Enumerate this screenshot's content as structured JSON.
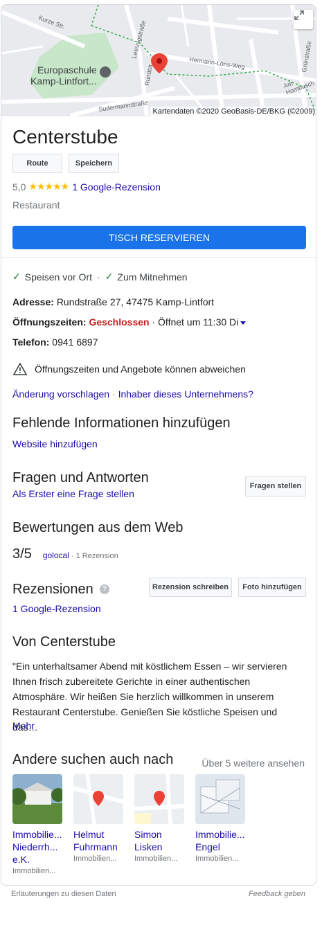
{
  "map": {
    "places": {
      "school": "Europaschule Kamp-Lintfort",
      "school_line1": "Europaschule",
      "school_line2": "Kamp-Lintfort..."
    },
    "streets": {
      "kurze": "Kurze Str.",
      "lessing": "Lessingstraße",
      "hermann": "Hermann-Löns-Weg",
      "gruen": "Grünstraße",
      "hombusch": "Am Hombusch",
      "sudermann": "Sudermannstraße",
      "rund": "Rundstr."
    },
    "credit": "Kartendaten ©2020 GeoBasis-DE/BKG (©2009)"
  },
  "business": {
    "name": "Centerstube",
    "route_label": "Route",
    "save_label": "Speichern",
    "rating": "5,0",
    "stars": "★★★★★",
    "review_link": "1 Google-Rezension",
    "category": "Restaurant",
    "reserve_label": "TISCH RESERVIEREN"
  },
  "features": {
    "dine_in": "Speisen vor Ort",
    "dot": "·",
    "takeaway": "Zum Mitnehmen"
  },
  "details": {
    "address_label": "Adresse:",
    "address": "Rundstraße 27, 47475 Kamp-Lintfort",
    "hours_label": "Öffnungszeiten:",
    "hours_status": "Geschlossen",
    "hours_next": "· Öffnet um 11:30 Di",
    "phone_label": "Telefon:",
    "phone": "0941 6897",
    "warning": "Öffnungszeiten und Angebote können abweichen",
    "suggest_edit": "Änderung vorschlagen",
    "owner": "Inhaber dieses Unternehmens?"
  },
  "missing": {
    "title": "Fehlende Informationen hinzufügen",
    "add_website": "Website hinzufügen"
  },
  "qa": {
    "title": "Fragen und Antworten",
    "first_question": "Als Erster eine Frage stellen",
    "ask_button": "Fragen stellen"
  },
  "web_reviews": {
    "title": "Bewertungen aus dem Web",
    "score": "3/5",
    "source": "golocal",
    "count": "· 1 Rezension"
  },
  "reviews": {
    "title": "Rezensionen",
    "write_button": "Rezension schreiben",
    "photo_button": "Foto hinzufügen",
    "link": "1 Google-Rezension"
  },
  "about": {
    "title": "Von Centerstube",
    "text": "\"Ein unterhaltsamer Abend mit köstlichem Essen – wir servieren Ihnen frisch zubereitete Gerichte in einer authentischen Atmosphäre. Wir heißen Sie herzlich willkommen in unserem Restaurant Centerstube. Genießen Sie köstliche Speisen und das…",
    "more": "Mehr"
  },
  "related": {
    "title": "Andere suchen auch nach",
    "see_more": "Über 5 weitere ansehen",
    "items": [
      {
        "name": "Immobilie... Niederrh... e.K.",
        "sub": "Immobilien..."
      },
      {
        "name": "Helmut Fuhrmann",
        "sub": "Immobilien..."
      },
      {
        "name": "Simon Lisken",
        "sub": "Immobilien..."
      },
      {
        "name": "Immobilie... Engel",
        "sub": "Immobilien..."
      }
    ]
  },
  "footer": {
    "explain": "Erläuterungen zu diesen Daten",
    "feedback": "Feedback geben"
  },
  "colors": {
    "accent": "#1a73e8",
    "link": "#1a0dab",
    "closed": "#c5221f",
    "star": "#fbbc04",
    "check": "#188038"
  }
}
